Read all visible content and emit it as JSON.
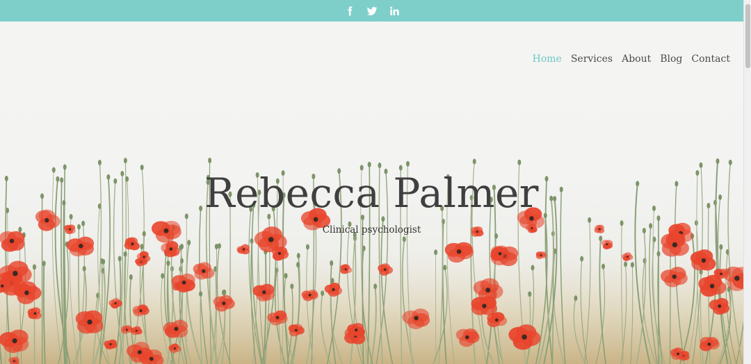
{
  "header": {
    "social_icons": [
      "facebook-icon",
      "twitter-icon",
      "linkedin-icon"
    ]
  },
  "nav": {
    "items": [
      {
        "label": "Home",
        "active": true
      },
      {
        "label": "Services",
        "active": false
      },
      {
        "label": "About",
        "active": false
      },
      {
        "label": "Blog",
        "active": false
      },
      {
        "label": "Contact",
        "active": false
      }
    ]
  },
  "hero": {
    "title": "Rebecca Palmer",
    "subtitle": "Clinical psychologist"
  },
  "colors": {
    "accent": "#7ecfca",
    "nav_active": "#6cc9c2",
    "text": "#3f3f3f",
    "poppy": "#e8452c"
  }
}
